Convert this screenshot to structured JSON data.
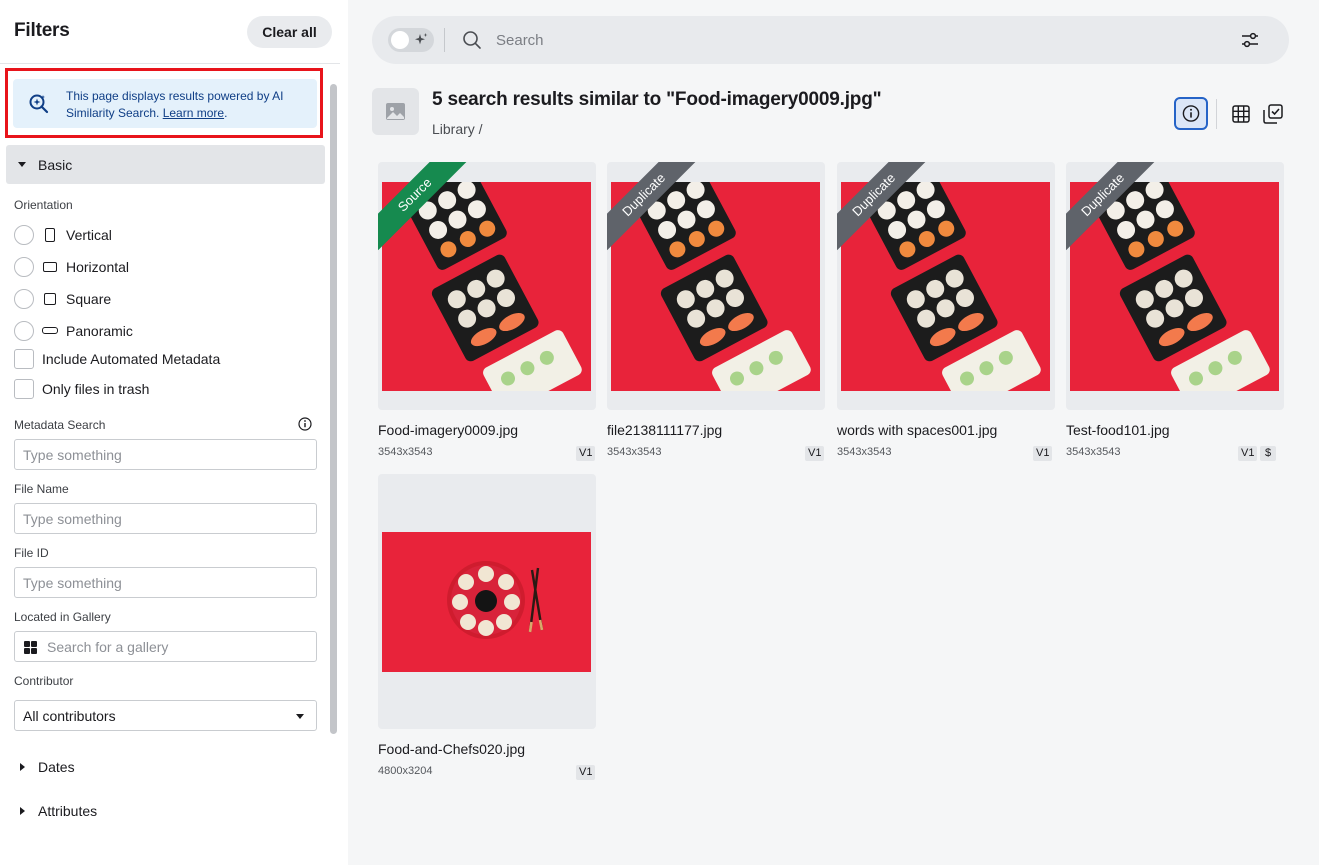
{
  "sidebar": {
    "title": "Filters",
    "clear_all": "Clear all",
    "notice": {
      "text": "This page displays results powered by AI Similarity Search.",
      "link": "Learn more"
    },
    "basic": {
      "label": "Basic",
      "orientation_label": "Orientation",
      "orientations": [
        "Vertical",
        "Horizontal",
        "Square",
        "Panoramic"
      ],
      "include_automated_metadata": "Include Automated Metadata",
      "only_files_in_trash": "Only files in trash",
      "metadata_search_label": "Metadata Search",
      "metadata_search_placeholder": "Type something",
      "file_name_label": "File Name",
      "file_name_placeholder": "Type something",
      "file_id_label": "File ID",
      "file_id_placeholder": "Type something",
      "gallery_label": "Located in Gallery",
      "gallery_placeholder": "Search for a gallery",
      "contributor_label": "Contributor",
      "contributor_value": "All contributors"
    },
    "collapsed_sections": [
      "Dates",
      "Attributes"
    ]
  },
  "search": {
    "placeholder": "Search"
  },
  "results": {
    "title": "5 search results similar to \"Food-imagery0009.jpg\"",
    "breadcrumb": "Library /",
    "items": [
      {
        "name": "Food-imagery0009.jpg",
        "dims": "3543x3543",
        "version": "V1",
        "ribbon": "Source"
      },
      {
        "name": "file2138111177.jpg",
        "dims": "3543x3543",
        "version": "V1",
        "ribbon": "Duplicate"
      },
      {
        "name": "words with spaces001.jpg",
        "dims": "3543x3543",
        "version": "V1",
        "ribbon": "Duplicate"
      },
      {
        "name": "Test-food101.jpg",
        "dims": "3543x3543",
        "version": "V1",
        "ribbon": "Duplicate",
        "price_badge": "$"
      },
      {
        "name": "Food-and-Chefs020.jpg",
        "dims": "4800x3204",
        "version": "V1"
      }
    ]
  },
  "colors": {
    "accent": "#2563c7",
    "source_ribbon": "#168a4f",
    "duplicate_ribbon": "#5f636a",
    "notice_bg": "#e4f1fb",
    "highlight_outline": "#e8141b",
    "photo_red": "#e8233a"
  }
}
